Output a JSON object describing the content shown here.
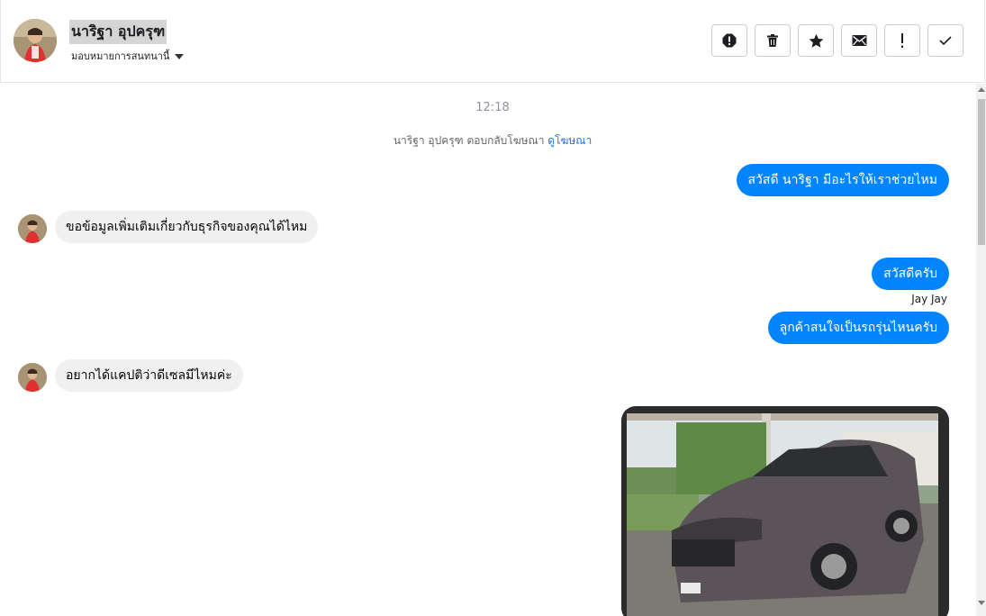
{
  "header": {
    "contact_name": "นาริฐา อุปครุฑ",
    "assign_label": "มอบหมายการสนทนานี้",
    "actions": [
      "spam-icon",
      "trash-icon",
      "star-icon",
      "envelope-icon",
      "important-icon",
      "check-icon"
    ]
  },
  "thread": {
    "timestamp": "12:18",
    "ad_reply_text": "นาริฐา อุปครุฑ ตอบกลับโฆษณา ",
    "ad_link": "ดูโฆษณา",
    "messages": [
      {
        "direction": "outgoing",
        "text": "สวัสดี นาริฐา มีอะไรให้เราช่วยไหม"
      },
      {
        "direction": "incoming",
        "text": "ขอข้อมูลเพิ่มเติมเกี่ยวกับธุรกิจของคุณได้ไหม"
      },
      {
        "direction": "outgoing",
        "text": "สวัสดีครับ"
      },
      {
        "direction": "outgoing",
        "text": "ลูกค้าสนใจเป็นรถรุ่นไหนครับ",
        "sender": "Jay Jay"
      },
      {
        "direction": "incoming",
        "text": "อยากได้แคปติว่าดีเซลมีไหมค่ะ"
      },
      {
        "direction": "outgoing",
        "type": "image",
        "alt": "car-photo"
      }
    ]
  },
  "colors": {
    "outgoing_bubble": "#0084ff",
    "incoming_bubble": "#f0f0f0",
    "link": "#1b74e4"
  }
}
